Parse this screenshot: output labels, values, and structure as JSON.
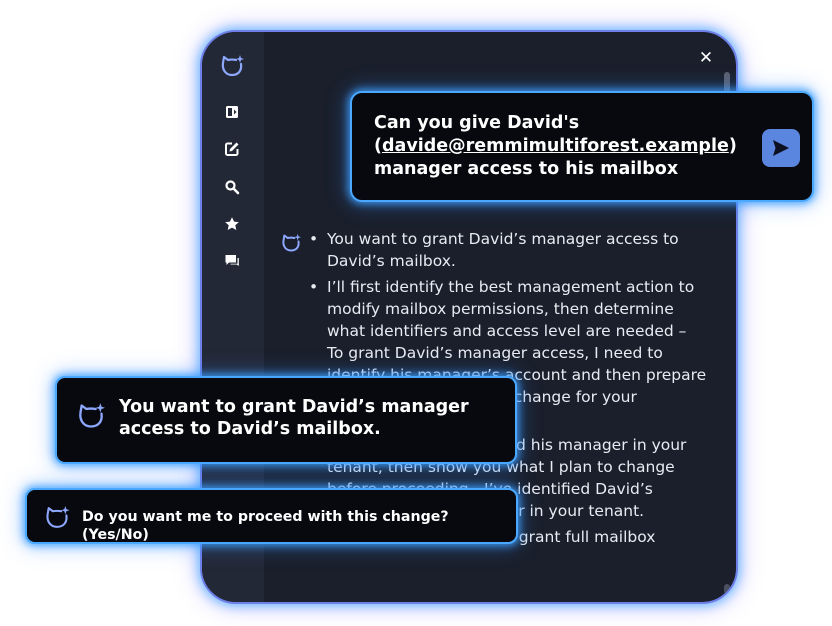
{
  "panel": {
    "close_label": "✕",
    "response_bullets": [
      "You want to grant David’s manager access to David’s mailbox.",
      "I’ll first identify the best management action to modify mailbox permissions, then determine what identifiers and access level are needed – To grant David’s manager access, I need to identify his manager’s account and then prepare the mailbox-permission change for your confirmation.",
      "I’ll first look up David and his manager in your tenant, then show you what I plan to change before proceeding.- I’ve identified David’s account and his manager in your tenant.",
      "The available action will grant full mailbox"
    ]
  },
  "sidebar": {
    "icons": [
      "copilot-logo",
      "panel-icon",
      "compose-icon",
      "search-icon",
      "star-icon",
      "chat-icon"
    ]
  },
  "callouts": {
    "user_prompt": {
      "prefix": "Can you give David's (",
      "email": "davide@remmimultiforest.example",
      "suffix": ") manager access to his mailbox"
    },
    "summary": "You want to grant David’s manager access to David’s mailbox.",
    "question": "Do you want me to proceed with this change? (Yes/No)"
  },
  "colors": {
    "accent": "#4aa8ff",
    "send_button": "#5b86df",
    "panel_bg": "#1a1f2b",
    "sidebar_bg": "#232836"
  }
}
